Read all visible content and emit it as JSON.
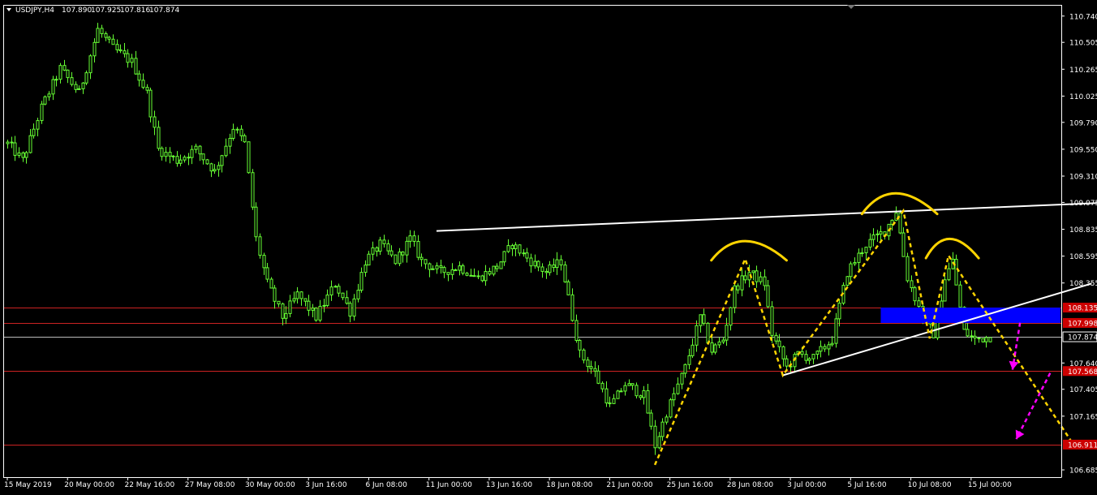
{
  "symbol_header": {
    "symbol": "USDJPY,H4",
    "open": "107.890",
    "high": "107.925",
    "low": "107.816",
    "close": "107.874"
  },
  "colors": {
    "background": "#000000",
    "candle": "#66ff33",
    "axis": "#ffffff",
    "level_line": "#cc2222",
    "current_price_line": "#bbbbbb",
    "trendline": "#ffffff",
    "pattern": "#ffd400",
    "target_arrow": "#ff00ff",
    "zone": "#0000ff",
    "price_tag_red": "#cc0000"
  },
  "chart_data": {
    "type": "candlestick",
    "instrument": "USDJPY",
    "timeframe": "H4",
    "y_ticks": [
      "110.740",
      "110.505",
      "110.265",
      "110.025",
      "109.790",
      "109.550",
      "109.310",
      "109.075",
      "108.835",
      "108.595",
      "108.355",
      "107.640",
      "107.405",
      "107.165",
      "106.685"
    ],
    "ylim": [
      106.62,
      110.84
    ],
    "x_ticks": [
      "15 May 2019",
      "20 May 00:00",
      "22 May 16:00",
      "27 May 08:00",
      "30 May 00:00",
      "3 Jun 16:00",
      "6 Jun 08:00",
      "11 Jun 00:00",
      "13 Jun 16:00",
      "18 Jun 08:00",
      "21 Jun 00:00",
      "25 Jun 16:00",
      "28 Jun 08:00",
      "3 Jul 00:00",
      "5 Jul 16:00",
      "10 Jul 08:00",
      "15 Jul 00:00"
    ],
    "x_tick_index": [
      0,
      16,
      32,
      48,
      64,
      80,
      96,
      112,
      128,
      144,
      160,
      176,
      192,
      208,
      224,
      240,
      256
    ],
    "bar_count": 262,
    "close_path": [
      [
        0,
        109.6
      ],
      [
        4,
        109.45
      ],
      [
        9,
        109.92
      ],
      [
        14,
        110.27
      ],
      [
        19,
        110.05
      ],
      [
        24,
        110.62
      ],
      [
        28,
        110.45
      ],
      [
        33,
        110.33
      ],
      [
        37,
        110.05
      ],
      [
        40,
        109.55
      ],
      [
        45,
        109.45
      ],
      [
        50,
        109.55
      ],
      [
        55,
        109.35
      ],
      [
        60,
        109.75
      ],
      [
        63,
        109.6
      ],
      [
        66,
        108.75
      ],
      [
        69,
        108.35
      ],
      [
        73,
        108.05
      ],
      [
        77,
        108.25
      ],
      [
        82,
        108.05
      ],
      [
        87,
        108.35
      ],
      [
        91,
        108.1
      ],
      [
        95,
        108.55
      ],
      [
        99,
        108.7
      ],
      [
        103,
        108.55
      ],
      [
        107,
        108.75
      ],
      [
        110,
        108.55
      ],
      [
        115,
        108.45
      ],
      [
        120,
        108.5
      ],
      [
        125,
        108.4
      ],
      [
        130,
        108.5
      ],
      [
        134,
        108.7
      ],
      [
        139,
        108.55
      ],
      [
        143,
        108.45
      ],
      [
        147,
        108.55
      ],
      [
        152,
        107.72
      ],
      [
        156,
        107.55
      ],
      [
        160,
        107.25
      ],
      [
        164,
        107.45
      ],
      [
        169,
        107.35
      ],
      [
        172,
        106.9
      ],
      [
        175,
        107.2
      ],
      [
        180,
        107.6
      ],
      [
        184,
        108.05
      ],
      [
        187,
        107.75
      ],
      [
        190,
        107.85
      ],
      [
        193,
        108.3
      ],
      [
        197,
        108.45
      ],
      [
        201,
        108.35
      ],
      [
        203,
        107.9
      ],
      [
        207,
        107.6
      ],
      [
        210,
        107.72
      ],
      [
        214,
        107.68
      ],
      [
        219,
        107.85
      ],
      [
        223,
        108.45
      ],
      [
        228,
        108.7
      ],
      [
        233,
        108.82
      ],
      [
        236,
        109.0
      ],
      [
        239,
        108.4
      ],
      [
        243,
        108.05
      ],
      [
        246,
        107.9
      ],
      [
        249,
        108.4
      ],
      [
        251,
        108.55
      ],
      [
        254,
        107.92
      ],
      [
        257,
        107.85
      ],
      [
        260,
        107.87
      ],
      [
        261,
        107.874
      ]
    ],
    "horizontal_levels": [
      {
        "price": 108.135,
        "label": "108.135"
      },
      {
        "price": 107.998,
        "label": "107.998"
      },
      {
        "price": 107.568,
        "label": "107.568"
      },
      {
        "price": 106.911,
        "label": "106.911"
      }
    ],
    "current_price": {
      "price": 107.874,
      "label": "107.874"
    },
    "zone": {
      "from_bar": 232,
      "to_bar": 262,
      "price_top": 108.135,
      "price_bottom": 107.998
    },
    "trendlines": [
      {
        "from": [
          114,
          108.82
        ],
        "to": [
          297,
          109.08
        ],
        "color": "trendline"
      },
      {
        "from": [
          206,
          107.53
        ],
        "to": [
          288,
          108.35
        ],
        "color": "trendline"
      }
    ],
    "pattern_zigzag": [
      [
        172,
        106.73
      ],
      [
        196,
        108.57
      ],
      [
        206,
        107.53
      ],
      [
        238,
        109.0
      ],
      [
        245,
        107.86
      ],
      [
        250,
        108.6
      ],
      [
        283,
        106.92
      ]
    ],
    "pattern_arcs": [
      {
        "center": [
          197,
          108.63
        ],
        "halfwidth_bars": 10,
        "height": 0.13
      },
      {
        "center": [
          237,
          109.05
        ],
        "halfwidth_bars": 10,
        "height": 0.14
      },
      {
        "center": [
          251,
          108.65
        ],
        "halfwidth_bars": 7,
        "height": 0.13
      }
    ],
    "target_arrows": [
      {
        "from": [
          269,
          108.0
        ],
        "to": [
          267,
          107.58
        ]
      },
      {
        "from": [
          277,
          107.55
        ],
        "to": [
          268,
          106.96
        ]
      }
    ]
  }
}
